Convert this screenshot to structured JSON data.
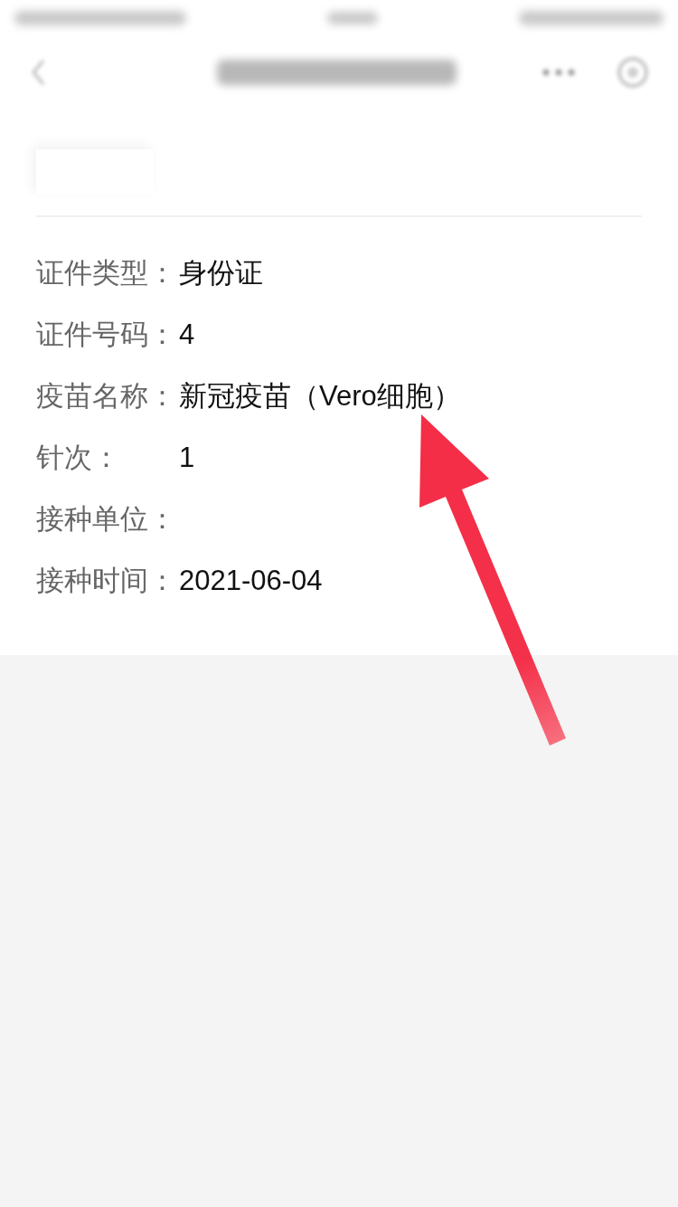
{
  "record": {
    "fields": [
      {
        "label": "证件类型：",
        "value": "身份证"
      },
      {
        "label": "证件号码：",
        "value": "4"
      },
      {
        "label": "疫苗名称：",
        "value": "新冠疫苗（Vero细胞）"
      },
      {
        "label": "针次：",
        "value": "1"
      },
      {
        "label": "接种单位："
      },
      {
        "label": "接种时间：",
        "value": "2021-06-04"
      }
    ]
  }
}
